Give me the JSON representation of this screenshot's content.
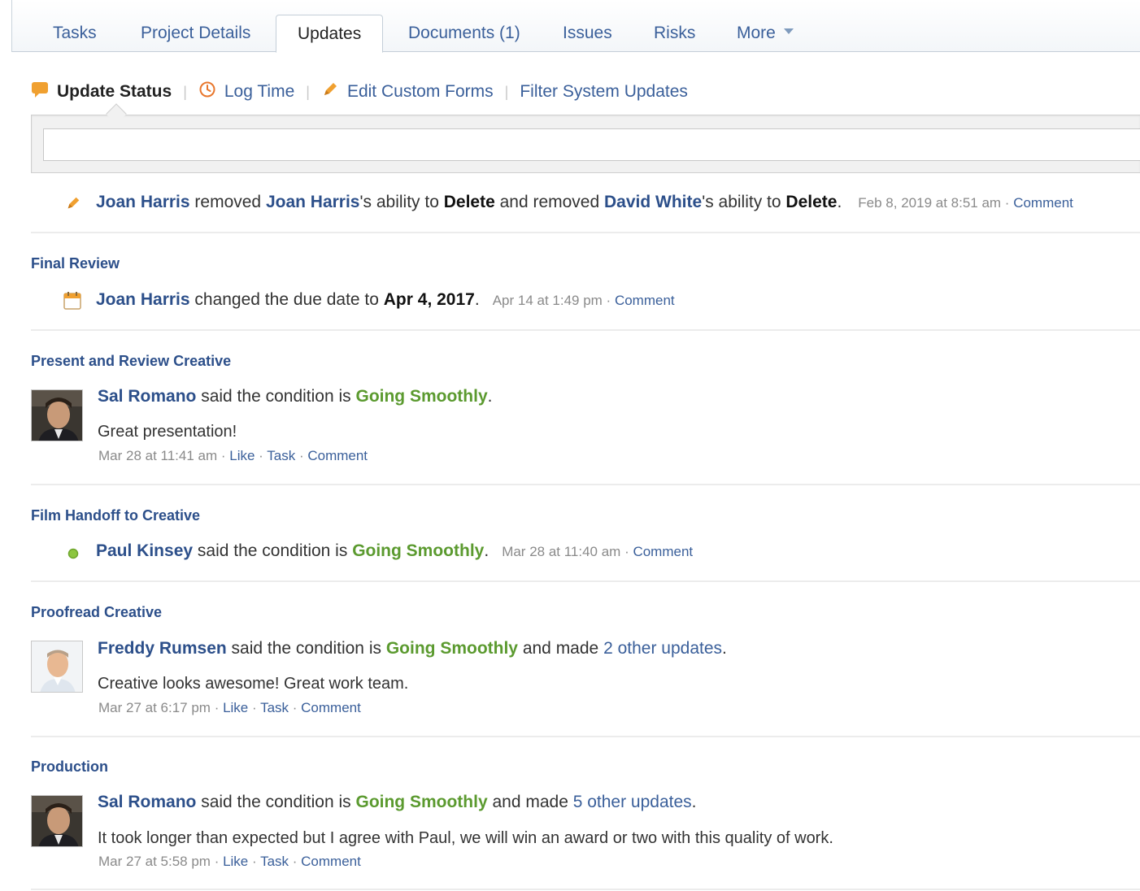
{
  "tabs": [
    {
      "label": "Tasks"
    },
    {
      "label": "Project Details"
    },
    {
      "label": "Updates"
    },
    {
      "label": "Documents (1)"
    },
    {
      "label": "Issues"
    },
    {
      "label": "Risks"
    },
    {
      "label": "More"
    }
  ],
  "toolbar": {
    "update_status": "Update Status",
    "log_time": "Log Time",
    "edit_custom_forms": "Edit Custom Forms",
    "filter_system_updates": "Filter System Updates",
    "separator": "|"
  },
  "composer": {
    "placeholder": ""
  },
  "colors": {
    "link": "#2c4f8a",
    "status_green": "#5b9a2f",
    "accent_orange": "#f0a030"
  },
  "feed": {
    "u0": {
      "icon": "pencil-icon",
      "actor": "Joan Harris",
      "t1": " removed ",
      "target1": "Joan Harris",
      "t2": "'s ability to ",
      "ability1": "Delete",
      "t3": " and removed ",
      "target2": "David White",
      "t4": "'s ability to ",
      "ability2": "Delete",
      "t5": ".",
      "timestamp": "Feb 8, 2019 at 8:51 am",
      "dot": " · ",
      "comment": "Comment"
    },
    "s1": {
      "title": "Final Review",
      "icon": "calendar-icon",
      "actor": "Joan Harris",
      "t1": " changed the due date to ",
      "date": "Apr 4, 2017",
      "t2": ".",
      "timestamp": "Apr 14 at 1:49 pm",
      "dot": " · ",
      "comment": "Comment"
    },
    "s2": {
      "title": "Present and Review Creative",
      "actor": "Sal Romano",
      "t1": " said the condition is ",
      "condition": "Going Smoothly",
      "t2": ".",
      "message": "Great presentation!",
      "timestamp": "Mar 28 at 11:41 am",
      "dot": " · ",
      "like": "Like",
      "task": "Task",
      "comment": "Comment"
    },
    "s3": {
      "title": "Film Handoff to Creative",
      "icon": "status-dot-icon",
      "actor": "Paul Kinsey",
      "t1": " said the condition is ",
      "condition": "Going Smoothly",
      "t2": ".",
      "timestamp": "Mar 28 at 11:40 am",
      "dot": " · ",
      "comment": "Comment"
    },
    "s4": {
      "title": "Proofread Creative",
      "actor": "Freddy Rumsen",
      "t1": " said the condition is ",
      "condition": "Going Smoothly",
      "t2": " and made ",
      "other": "2 other updates",
      "t3": ".",
      "message": "Creative looks awesome! Great work team.",
      "timestamp": "Mar 27 at 6:17 pm",
      "dot": " · ",
      "like": "Like",
      "task": "Task",
      "comment": "Comment"
    },
    "s5": {
      "title": "Production",
      "actor": "Sal Romano",
      "t1": " said the condition is ",
      "condition": "Going Smoothly",
      "t2": " and made ",
      "other": "5 other updates",
      "t3": ".",
      "message": "It took longer than expected but I agree with Paul, we will win an award or two with this quality of work.",
      "timestamp": "Mar 27 at 5:58 pm",
      "dot": " · ",
      "like": "Like",
      "task": "Task",
      "comment": "Comment"
    }
  }
}
